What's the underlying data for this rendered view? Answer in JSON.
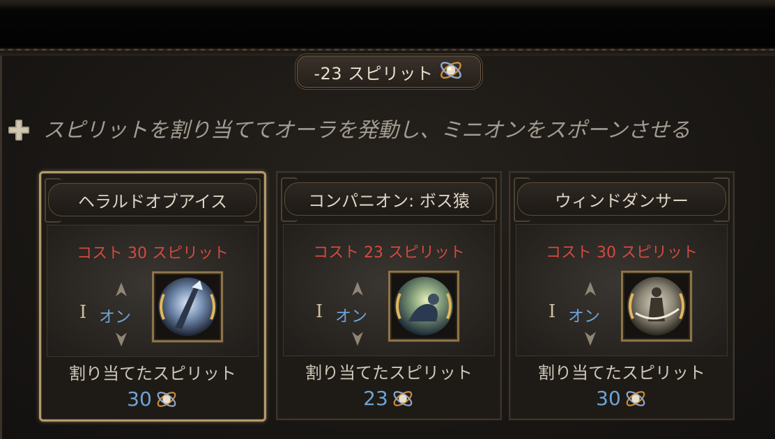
{
  "header": {
    "spirit_delta": "-23 スピリット",
    "icon": "spirit-icon"
  },
  "description": {
    "icon": "plus-icon",
    "text": "スピリットを割り当ててオーラを発動し、ミニオンをスポーンさせる"
  },
  "cards": [
    {
      "title": "ヘラルドオブアイス",
      "cost": "コスト 30 スピリット",
      "level": "I",
      "state": "オン",
      "skill_icon": "herald-of-ice-icon",
      "alloc_label": "割り当てたスピリット",
      "alloc_value": "30",
      "selected": true
    },
    {
      "title": "コンパニオン: ボス猿",
      "cost": "コスト 23 スピリット",
      "level": "I",
      "state": "オン",
      "skill_icon": "companion-icon",
      "alloc_label": "割り当てたスピリット",
      "alloc_value": "23",
      "selected": false
    },
    {
      "title": "ウィンドダンサー",
      "cost": "コスト 30 スピリット",
      "level": "I",
      "state": "オン",
      "skill_icon": "wind-dancer-icon",
      "alloc_label": "割り当てたスピリット",
      "alloc_value": "30",
      "selected": false
    }
  ],
  "colors": {
    "cost": "#d44a3f",
    "value_blue": "#6ea4d6",
    "gold_border": "#b29a6c"
  }
}
